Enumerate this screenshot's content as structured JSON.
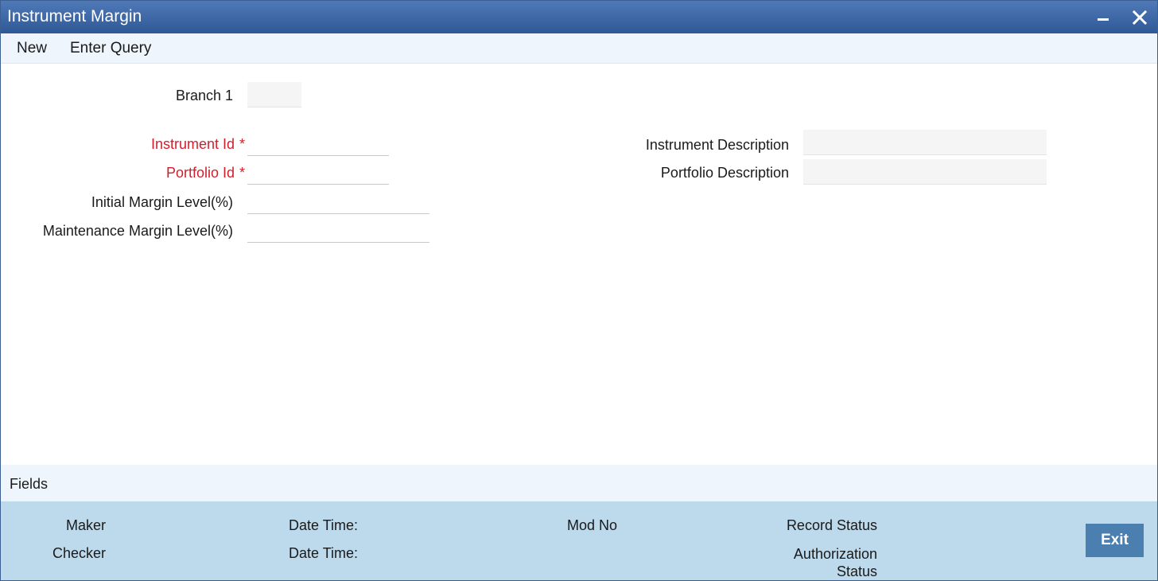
{
  "window": {
    "title": "Instrument Margin",
    "controls": {
      "minimize_icon": "minimize-icon",
      "close_icon": "close-icon"
    }
  },
  "menu": {
    "new_label": "New",
    "enter_query_label": "Enter Query"
  },
  "form": {
    "branch_label": "Branch 1",
    "branch_value": "",
    "instrument_id_label": "Instrument Id",
    "instrument_id_value": "",
    "portfolio_id_label": "Portfolio Id",
    "portfolio_id_value": "",
    "required_mark": "*",
    "initial_margin_label": "Initial Margin Level(%)",
    "initial_margin_value": "",
    "maintenance_margin_label": "Maintenance Margin Level(%)",
    "maintenance_margin_value": "",
    "instrument_description_label": "Instrument Description",
    "instrument_description_value": "",
    "portfolio_description_label": "Portfolio Description",
    "portfolio_description_value": ""
  },
  "fields_section": {
    "title": "Fields"
  },
  "footer": {
    "maker_label": "Maker",
    "checker_label": "Checker",
    "maker_date_time_label": "Date Time:",
    "checker_date_time_label": "Date Time:",
    "mod_no_label": "Mod No",
    "record_status_label": "Record Status",
    "authorization_status_label_line1": "Authorization",
    "authorization_status_label_line2": "Status",
    "exit_label": "Exit"
  },
  "colors": {
    "titlebar": "#3d68a8",
    "required_text": "#d0202e",
    "menubar_bg": "#eef5fc",
    "footer_bg": "#bdd9ec",
    "exit_button": "#4a7fb0"
  }
}
